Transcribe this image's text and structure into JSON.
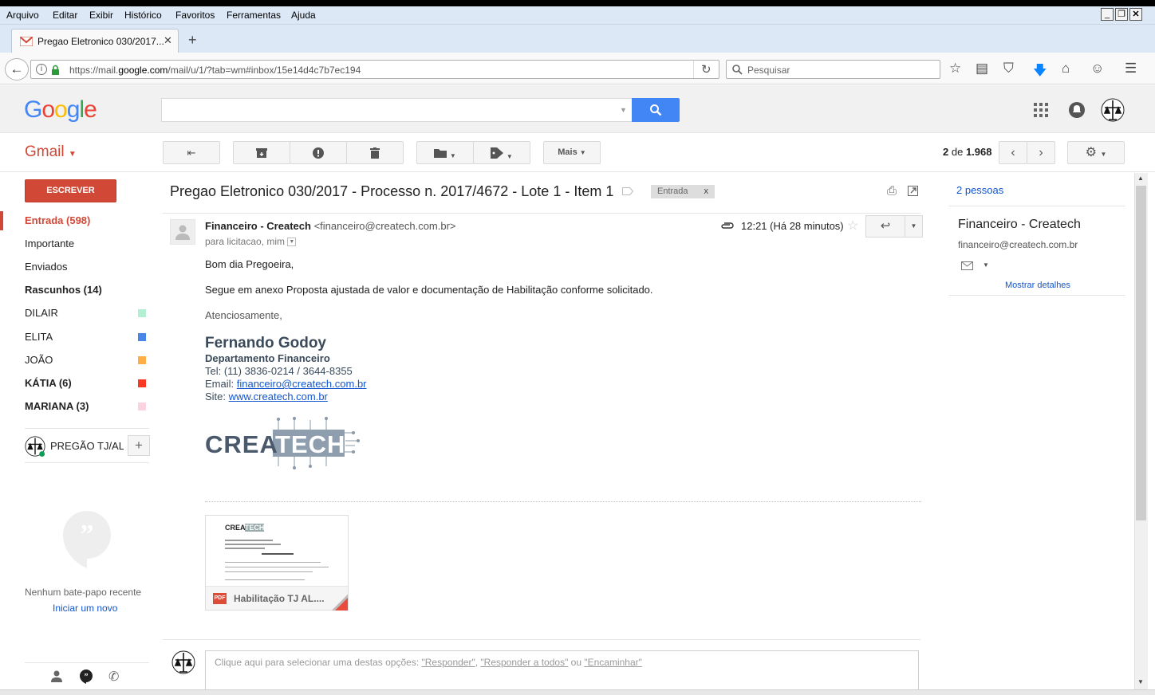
{
  "browser": {
    "menu": [
      "Arquivo",
      "Editar",
      "Exibir",
      "Histórico",
      "Favoritos",
      "Ferramentas",
      "Ajuda"
    ],
    "tab_title": "Pregao Eletronico 030/2017...",
    "url_prefix": "https://mail.",
    "url_domain": "google.com",
    "url_rest": "/mail/u/1/?tab=wm#inbox/15e14d4c7b7ec194",
    "search_placeholder": "Pesquisar"
  },
  "gmail": {
    "label": "Gmail",
    "pagination": {
      "current": "2",
      "of": "de",
      "total": "1.968"
    },
    "more_label": "Mais",
    "compose_label": "ESCREVER",
    "nav": [
      {
        "label": "Entrada (598)",
        "bold": true,
        "active": true,
        "color": ""
      },
      {
        "label": "Importante",
        "bold": false,
        "color": ""
      },
      {
        "label": "Enviados",
        "bold": false,
        "color": ""
      },
      {
        "label": "Rascunhos (14)",
        "bold": true,
        "color": ""
      },
      {
        "label": "DILAIR",
        "bold": false,
        "color": "#b3efd3"
      },
      {
        "label": "ELITA",
        "bold": false,
        "color": "#4986e7"
      },
      {
        "label": "JOÃO",
        "bold": false,
        "color": "#ffad46"
      },
      {
        "label": "KÁTIA (6)",
        "bold": true,
        "color": "#f83a22"
      },
      {
        "label": "MARIANA (3)",
        "bold": true,
        "color": "#fbd3e0"
      }
    ],
    "hangouts_user": "PREGÃO TJ/AL",
    "no_chat": "Nenhum bate-papo recente",
    "start_new": "Iniciar um novo"
  },
  "thread": {
    "subject": "Pregao Eletronico 030/2017 - Processo n. 2017/4672 - Lote 1 - Item 1",
    "label_chip": "Entrada",
    "label_close": "x",
    "sender_name": "Financeiro - Createch",
    "sender_email": "<financeiro@createch.com.br>",
    "to": "para licitacao, mim",
    "time": "12:21 (Há 28 minutos)",
    "body": [
      "Bom dia Pregoeira,",
      "Segue em anexo Proposta ajustada de valor e documentação de Habilitação conforme solicitado.",
      "Atenciosamente,"
    ],
    "sig_name": "Fernando Godoy",
    "sig_dept": "Departamento Financeiro",
    "sig_tel": "Tel: (11) 3836-0214 / 3644-8355",
    "sig_email_label": "Email: ",
    "sig_email": "financeiro@createch.com.br",
    "sig_site_label": "Site: ",
    "sig_site": "www.createch.com.br",
    "logo_crea": "CREA",
    "logo_tech": "TECH",
    "attachment_name": "Habilitação TJ AL....",
    "attachment_type": "PDF",
    "reply_hint_prefix": "Clique aqui para selecionar uma destas opções: ",
    "reply_opt1": "\"Responder\"",
    "reply_opt2": "\"Responder a todos\"",
    "reply_or": " ou ",
    "reply_opt3": "\"Encaminhar\""
  },
  "people": {
    "count": "2 pessoas",
    "name": "Financeiro - Createch",
    "email": "financeiro@createch.com.br",
    "details": "Mostrar detalhes"
  },
  "colors": {
    "accent_red": "#d14836",
    "google_blue": "#4285f4",
    "link": "#1155cc"
  }
}
